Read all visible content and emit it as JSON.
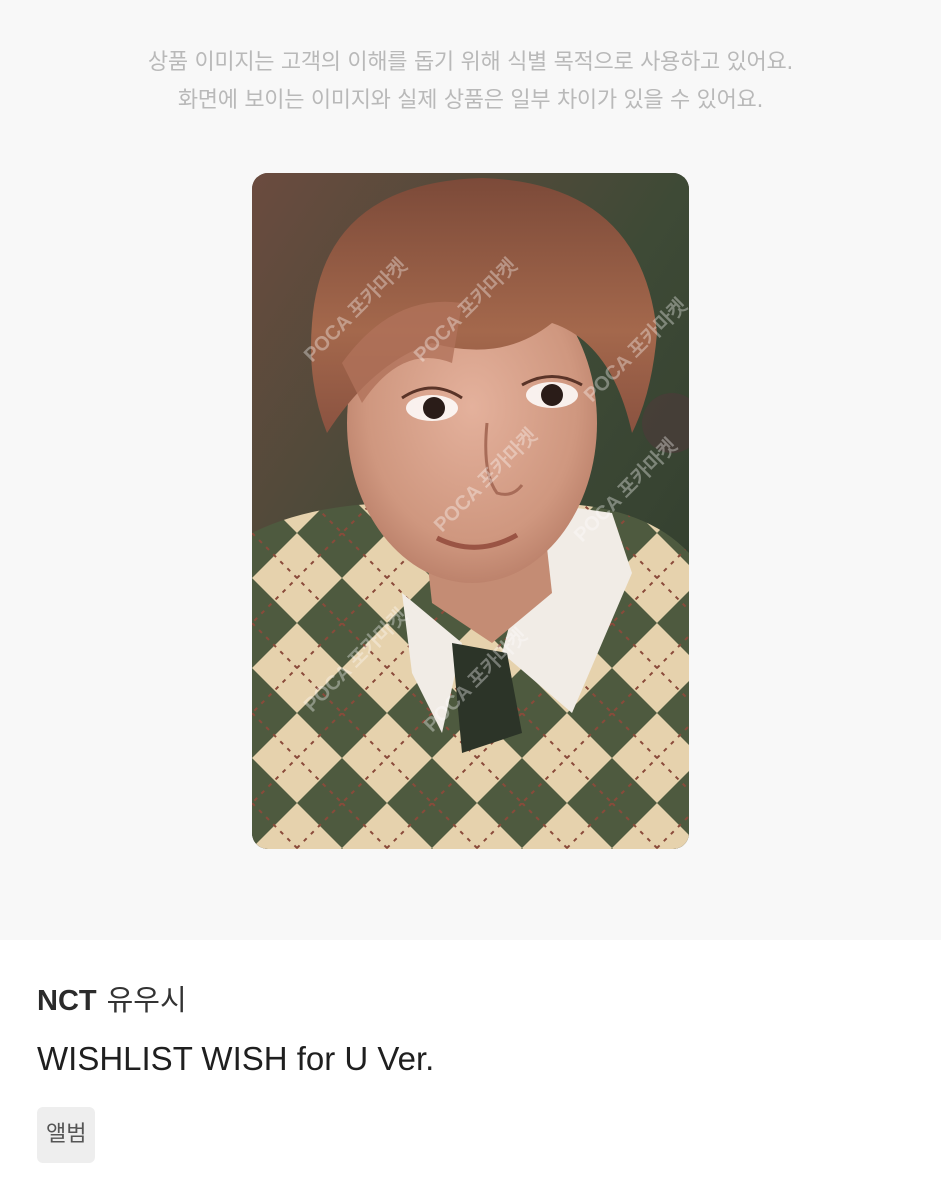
{
  "disclaimer": {
    "line1": "상품 이미지는 고객의 이해를 돕기 위해 식별 목적으로 사용하고 있어요.",
    "line2": "화면에 보이는 이미지와 실제 상품은 일부 차이가 있을 수 있어요."
  },
  "photocard": {
    "watermark": "POCA 포카마켓",
    "colors": {
      "hair": "#9a5e46",
      "skin": "#d8a48e",
      "sweater_green": "#4e5a3f",
      "argyle_cream": "#e6d2ad",
      "collar": "#f1ece6",
      "background": "#3d4a35"
    }
  },
  "product": {
    "group": "NCT",
    "member": "유우시",
    "title": "WISHLIST WISH for U Ver.",
    "category_tag": "앨범"
  }
}
